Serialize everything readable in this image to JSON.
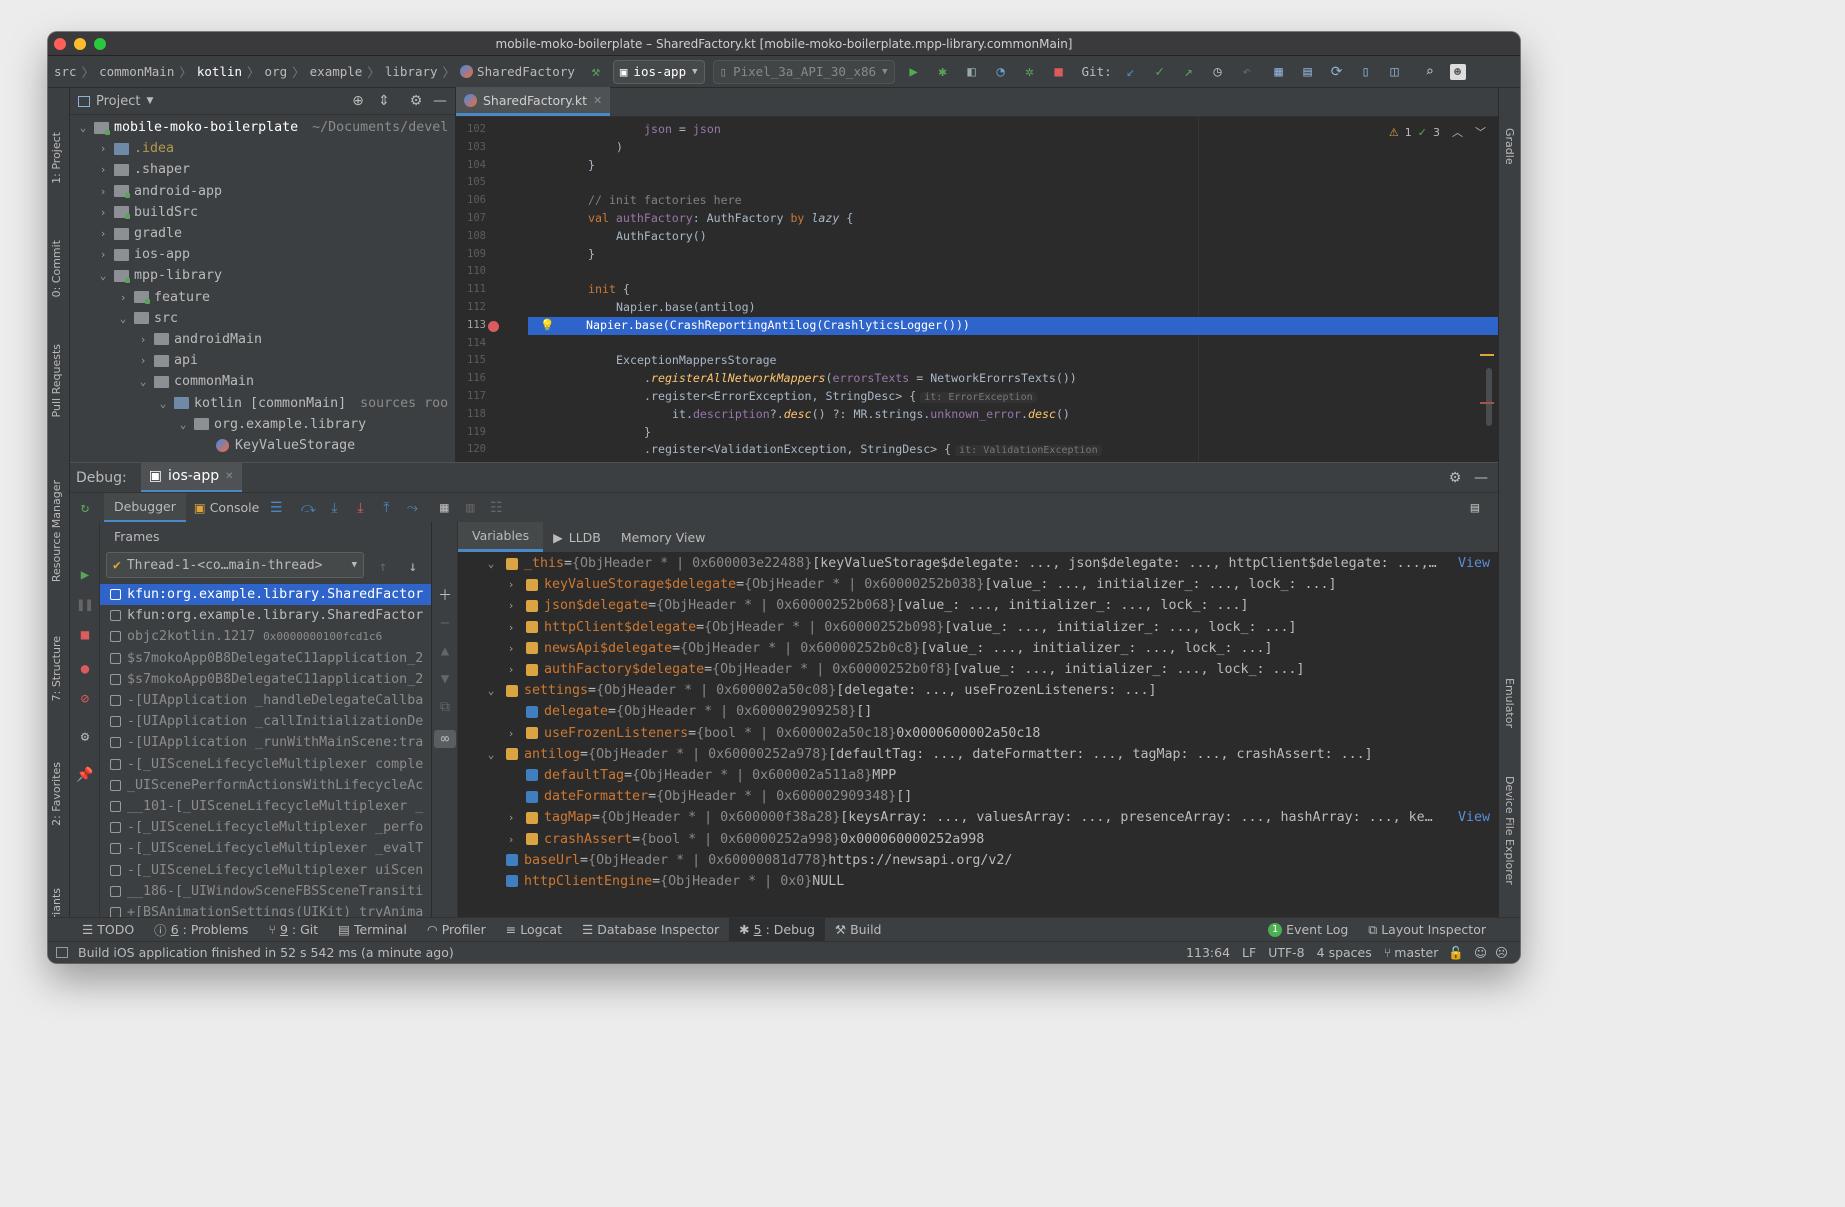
{
  "window": {
    "title": "mobile-moko-boilerplate – SharedFactory.kt [mobile-moko-boilerplate.mpp-library.commonMain]"
  },
  "breadcrumb": [
    "src",
    "commonMain",
    "kotlin",
    "org",
    "example",
    "library",
    "SharedFactory"
  ],
  "toolbar": {
    "run_config": "ios-app",
    "device": "Pixel_3a_API_30_x86",
    "git_label": "Git:"
  },
  "project_panel": {
    "title": "Project",
    "tree": [
      {
        "name": "mobile-moko-boilerplate",
        "extra": "~/Documents/devel"
      },
      {
        "name": ".idea"
      },
      {
        "name": ".shaper"
      },
      {
        "name": "android-app"
      },
      {
        "name": "buildSrc"
      },
      {
        "name": "gradle"
      },
      {
        "name": "ios-app"
      },
      {
        "name": "mpp-library"
      },
      {
        "name": "feature"
      },
      {
        "name": "src"
      },
      {
        "name": "androidMain"
      },
      {
        "name": "api"
      },
      {
        "name": "commonMain"
      },
      {
        "name": "kotlin [commonMain]",
        "extra": "sources roo"
      },
      {
        "name": "org.example.library"
      },
      {
        "name": "KeyValueStorage"
      }
    ]
  },
  "editor": {
    "tab_label": "SharedFactory.kt",
    "inspection_warnings": "1",
    "inspection_ok": "3",
    "line_numbers": [
      "102",
      "103",
      "104",
      "105",
      "106",
      "107",
      "108",
      "109",
      "110",
      "111",
      "112",
      "113",
      "114",
      "115",
      "116",
      "117",
      "118",
      "119",
      "120"
    ],
    "code": {
      "l102_a": "json",
      "l102_b": " = ",
      "l102_c": "json",
      "l103": ")",
      "l104": "}",
      "l106": "// init factories here",
      "l107_kw": "val ",
      "l107_name": "authFactory",
      "l107_rest": ": AuthFactory ",
      "l107_by": "by ",
      "l107_lazy": "lazy",
      "l107_end": " {",
      "l108": "AuthFactory()",
      "l109": "}",
      "l111_kw": "init",
      "l111_end": " {",
      "l112": "Napier.base(antilog)",
      "l113": "Napier.base(CrashReportingAntilog(CrashlyticsLogger()))",
      "l115": "ExceptionMappersStorage",
      "l116_a": ".",
      "l116_fn": "registerAllNetworkMappers",
      "l116_b": "(",
      "l116_param": "errorsTexts",
      "l116_c": " = NetworkErorrsTexts())",
      "l117_a": ".register<ErrorException, StringDesc> {",
      "l117_hint": "it: ErrorException",
      "l118_a": "it.",
      "l118_desc": "description",
      "l118_b": "?.",
      "l118_fn": "desc",
      "l118_c": "() ?: MR.strings.",
      "l118_prop": "unknown_error",
      "l118_d": ".",
      "l118_fn2": "desc",
      "l118_e": "()",
      "l119": "}",
      "l120_a": ".register<ValidationException, StringDesc> {",
      "l120_hint": "it: ValidationException"
    }
  },
  "debug": {
    "label": "Debug:",
    "session": "ios-app",
    "tab_debugger": "Debugger",
    "tab_console": "Console",
    "frames_title": "Frames",
    "thread": "Thread-1-<co…main-thread>",
    "frames": [
      {
        "text": "kfun:org.example.library.SharedFactor",
        "addr": ""
      },
      {
        "text": "kfun:org.example.library.SharedFactor",
        "addr": ""
      },
      {
        "text": "objc2kotlin.1217",
        "addr": "0x0000000100fcd1c6"
      },
      {
        "text": "$s7mokoApp0B8DelegateC11application_2",
        "addr": ""
      },
      {
        "text": "$s7mokoApp0B8DelegateC11application_2",
        "addr": ""
      },
      {
        "text": "-[UIApplication _handleDelegateCallba",
        "addr": ""
      },
      {
        "text": "-[UIApplication _callInitializationDe",
        "addr": ""
      },
      {
        "text": "-[UIApplication _runWithMainScene:tra",
        "addr": ""
      },
      {
        "text": "-[_UISceneLifecycleMultiplexer comple",
        "addr": ""
      },
      {
        "text": "_UIScenePerformActionsWithLifecycleAc",
        "addr": ""
      },
      {
        "text": "__101-[_UISceneLifecycleMultiplexer _",
        "addr": ""
      },
      {
        "text": "-[_UISceneLifecycleMultiplexer _perfo",
        "addr": ""
      },
      {
        "text": "-[_UISceneLifecycleMultiplexer _evalT",
        "addr": ""
      },
      {
        "text": "-[_UISceneLifecycleMultiplexer uiScen",
        "addr": ""
      },
      {
        "text": "__186-[_UIWindowSceneFBSSceneTransiti",
        "addr": ""
      },
      {
        "text": "+[BSAnimationSettings(UIKit) tryAnima",
        "addr": ""
      }
    ],
    "var_tabs": {
      "variables": "Variables",
      "lldb": "LLDB",
      "memory": "Memory View"
    },
    "variables": [
      {
        "name": "_this",
        "eq": " = ",
        "type": "{ObjHeader * | 0x600003e22488}",
        "value": " [keyValueStorage$delegate: ..., json$delegate: ..., httpClient$delegate: ...,…",
        "link": "View"
      },
      {
        "name": "keyValueStorage$delegate",
        "eq": " = ",
        "type": "{ObjHeader * | 0x60000252b038}",
        "value": " [value_: ..., initializer_: ..., lock_: ...]",
        "link": ""
      },
      {
        "name": "json$delegate",
        "eq": " = ",
        "type": "{ObjHeader * | 0x60000252b068}",
        "value": " [value_: ..., initializer_: ..., lock_: ...]",
        "link": ""
      },
      {
        "name": "httpClient$delegate",
        "eq": " = ",
        "type": "{ObjHeader * | 0x60000252b098}",
        "value": " [value_: ..., initializer_: ..., lock_: ...]",
        "link": ""
      },
      {
        "name": "newsApi$delegate",
        "eq": " = ",
        "type": "{ObjHeader * | 0x60000252b0c8}",
        "value": " [value_: ..., initializer_: ..., lock_: ...]",
        "link": ""
      },
      {
        "name": "authFactory$delegate",
        "eq": " = ",
        "type": "{ObjHeader * | 0x60000252b0f8}",
        "value": " [value_: ..., initializer_: ..., lock_: ...]",
        "link": ""
      },
      {
        "name": "settings",
        "eq": " = ",
        "type": "{ObjHeader * | 0x600002a50c08}",
        "value": " [delegate: ..., useFrozenListeners: ...]",
        "link": ""
      },
      {
        "name": "delegate",
        "eq": " = ",
        "type": "{ObjHeader * | 0x600002909258}",
        "value": " []",
        "link": ""
      },
      {
        "name": "useFrozenListeners",
        "eq": " = ",
        "type": "{bool * | 0x600002a50c18}",
        "value": " 0x0000600002a50c18",
        "link": ""
      },
      {
        "name": "antilog",
        "eq": " = ",
        "type": "{ObjHeader * | 0x60000252a978}",
        "value": " [defaultTag: ..., dateFormatter: ..., tagMap: ..., crashAssert: ...]",
        "link": ""
      },
      {
        "name": "defaultTag",
        "eq": " = ",
        "type": "{ObjHeader * | 0x600002a511a8}",
        "value": " MPP",
        "link": ""
      },
      {
        "name": "dateFormatter",
        "eq": " = ",
        "type": "{ObjHeader * | 0x600002909348}",
        "value": " []",
        "link": ""
      },
      {
        "name": "tagMap",
        "eq": " = ",
        "type": "{ObjHeader * | 0x600000f38a28}",
        "value": " [keysArray: ..., valuesArray: ..., presenceArray: ..., hashArray: ..., ke…",
        "link": "View"
      },
      {
        "name": "crashAssert",
        "eq": " = ",
        "type": "{bool * | 0x60000252a998}",
        "value": " 0x000060000252a998",
        "link": ""
      },
      {
        "name": "baseUrl",
        "eq": " = ",
        "type": "{ObjHeader * | 0x60000081d778}",
        "value": " https://newsapi.org/v2/",
        "link": ""
      },
      {
        "name": "httpClientEngine",
        "eq": " = ",
        "type": "{ObjHeader * | 0x0}",
        "value": " NULL",
        "link": ""
      }
    ]
  },
  "left_tool_tabs": [
    "1: Project",
    "0: Commit",
    "Pull Requests",
    "Resource Manager",
    "7: Structure",
    "2: Favorites",
    "Variants"
  ],
  "right_tool_tabs": [
    "Gradle",
    "Emulator",
    "Device File Explorer"
  ],
  "bottom_tabs": [
    {
      "num": "",
      "label": "TODO"
    },
    {
      "num": "6",
      "label": ": Problems"
    },
    {
      "num": "9",
      "label": ": Git"
    },
    {
      "num": "",
      "label": "Terminal"
    },
    {
      "num": "",
      "label": "Profiler"
    },
    {
      "num": "",
      "label": "Logcat"
    },
    {
      "num": "",
      "label": "Database Inspector"
    },
    {
      "num": "5",
      "label": ": Debug"
    },
    {
      "num": "",
      "label": "Build"
    }
  ],
  "bottom_right": {
    "event_count": "1",
    "event_log": "Event Log",
    "layout_inspector": "Layout Inspector"
  },
  "status": {
    "message": "Build iOS application finished in 52 s 542 ms (a minute ago)",
    "position": "113:64",
    "line_sep": "LF",
    "encoding": "UTF-8",
    "indent": "4 spaces",
    "branch": "master"
  },
  "colors": {
    "selection": "#2f65ca",
    "keyword": "#cc7832",
    "breakpoint": "#db5c5c",
    "run_green": "#4caf50"
  }
}
